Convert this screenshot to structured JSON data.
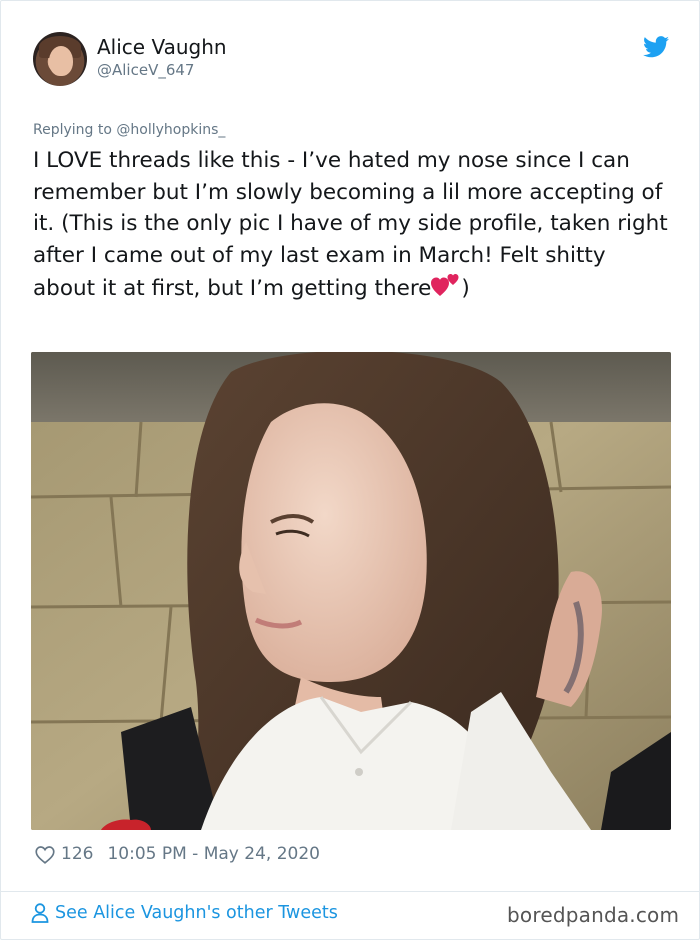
{
  "author": {
    "name": "Alice Vaughn",
    "handle": "@AliceV_647"
  },
  "replying_to": "Replying to @hollyhopkins_",
  "tweet": {
    "text_main": "I LOVE threads like this - I’ve hated my nose since I can remember but I’m slowly becoming a lil more accepting of it. (This is the only pic I have of my side profile, taken right after I came out of my last exam in March! Felt shitty about it at first, but I’m getting there",
    "emoji": "two-hearts-emoji",
    "text_end": ")"
  },
  "meta": {
    "likes": "126",
    "timestamp": "10:05 PM - May 24, 2020"
  },
  "footer": {
    "see_more": "See Alice Vaughn's other Tweets",
    "watermark": "boredpanda.com"
  },
  "colors": {
    "twitter_blue": "#1da1f2",
    "link_blue": "#1b95e0",
    "secondary_text": "#657786",
    "heart_pink": "#e0245e"
  },
  "icons": [
    "twitter-bird-icon",
    "heart-outline-icon",
    "person-icon",
    "two-hearts-emoji"
  ]
}
